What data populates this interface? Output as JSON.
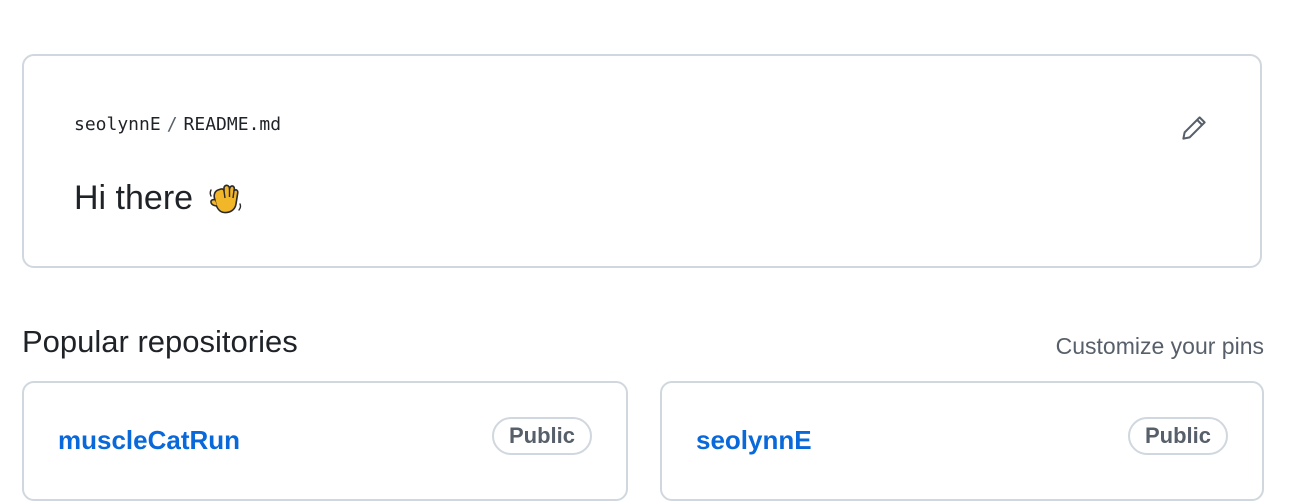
{
  "readme": {
    "owner": "seolynnE",
    "separator": "/",
    "file": "README.md",
    "heading": "Hi there",
    "heading_emoji_icon": "waving-hand-icon",
    "edit_icon": "pencil-icon"
  },
  "popular": {
    "title": "Popular repositories",
    "customize_label": "Customize your pins",
    "repos": [
      {
        "name": "muscleCatRun",
        "visibility": "Public"
      },
      {
        "name": "seolynnE",
        "visibility": "Public"
      }
    ]
  },
  "colors": {
    "link": "#0969da",
    "border": "#d0d7de",
    "muted": "#57606a",
    "text": "#1f2328"
  }
}
